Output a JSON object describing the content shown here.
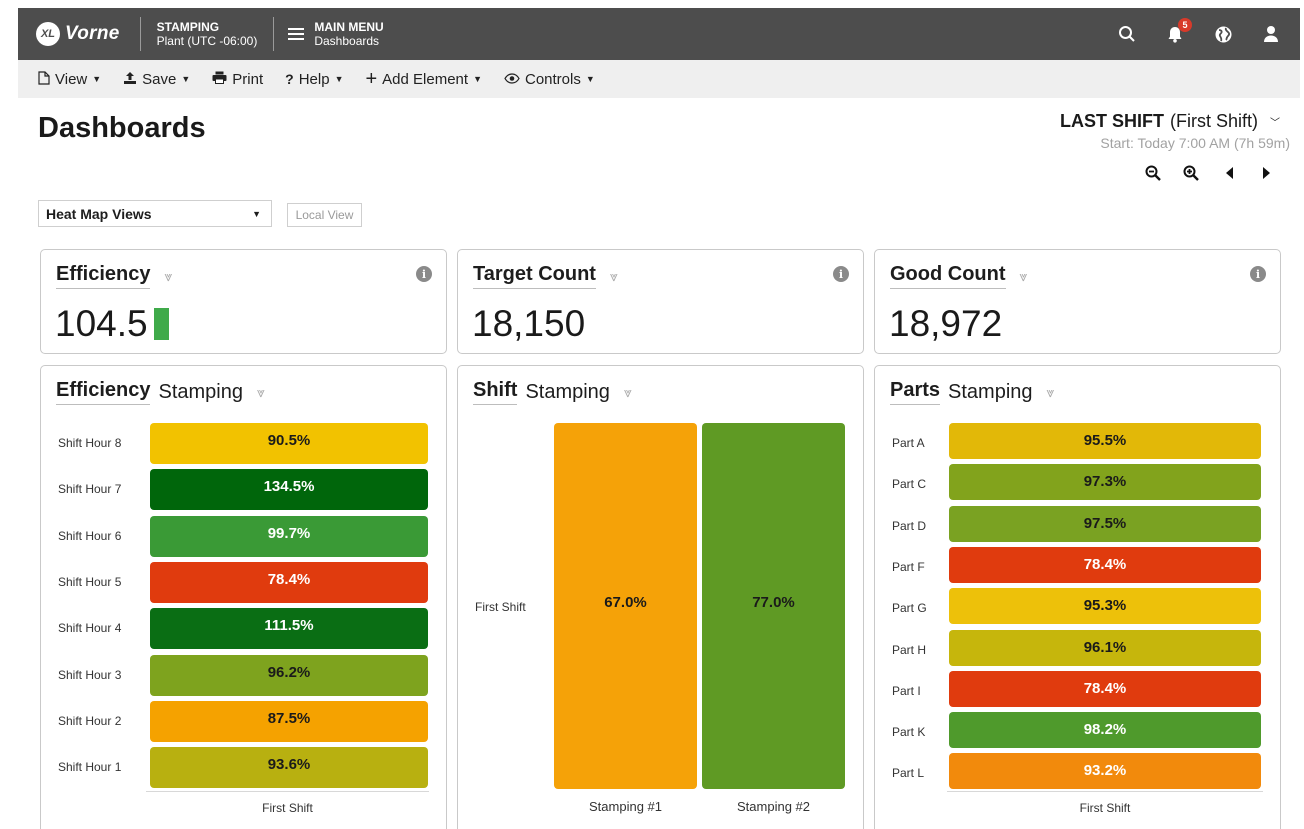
{
  "topbar": {
    "logo_badge": "XL",
    "logo_text": "Vorne",
    "area_title": "STAMPING",
    "area_sub": "Plant (UTC -06:00)",
    "menu_title": "MAIN MENU",
    "menu_sub": "Dashboards",
    "notification_count": "5"
  },
  "toolbar": {
    "view": "View",
    "save": "Save",
    "print": "Print",
    "help": "Help",
    "add_element": "Add Element",
    "controls": "Controls"
  },
  "header": {
    "title": "Dashboards",
    "shift_bold": "LAST SHIFT",
    "shift_name": "(First Shift)",
    "shift_start": "Start: Today 7:00 AM (7h 59m)"
  },
  "views": {
    "selected": "Heat Map Views",
    "local_view": "Local View"
  },
  "kpis": [
    {
      "title": "Efficiency",
      "value": "104.5",
      "indicator_color": "#3faa4a"
    },
    {
      "title": "Target Count",
      "value": "18,150"
    },
    {
      "title": "Good Count",
      "value": "18,972"
    }
  ],
  "efficiency_heatmap": {
    "title": "Efficiency",
    "subtitle": "Stamping",
    "x_label": "First Shift",
    "rows": [
      {
        "label": "Shift Hour 8",
        "value": "90.5%",
        "color": "#f2c200",
        "text_color": "#1a1a1a"
      },
      {
        "label": "Shift Hour 7",
        "value": "134.5%",
        "color": "#00660b",
        "text_color": "#ffffff"
      },
      {
        "label": "Shift Hour 6",
        "value": "99.7%",
        "color": "#3a9a36",
        "text_color": "#ffffff"
      },
      {
        "label": "Shift Hour 5",
        "value": "78.4%",
        "color": "#e03b0e",
        "text_color": "#ffffff"
      },
      {
        "label": "Shift Hour 4",
        "value": "111.5%",
        "color": "#0a6e14",
        "text_color": "#ffffff"
      },
      {
        "label": "Shift Hour 3",
        "value": "96.2%",
        "color": "#7ea31e",
        "text_color": "#1a1a1a"
      },
      {
        "label": "Shift Hour 2",
        "value": "87.5%",
        "color": "#f5a200",
        "text_color": "#1a1a1a"
      },
      {
        "label": "Shift Hour 1",
        "value": "93.6%",
        "color": "#b8b010",
        "text_color": "#1a1a1a"
      }
    ]
  },
  "shift_heatmap": {
    "title": "Shift",
    "subtitle": "Stamping",
    "y_label": "First Shift",
    "columns": [
      {
        "label": "Stamping #1",
        "value": "67.0%",
        "color": "#f5a208",
        "text_color": "#1a1a1a"
      },
      {
        "label": "Stamping #2",
        "value": "77.0%",
        "color": "#5f9a24",
        "text_color": "#1a1a1a"
      }
    ]
  },
  "parts_heatmap": {
    "title": "Parts",
    "subtitle": "Stamping",
    "x_label": "First Shift",
    "rows": [
      {
        "label": "Part A",
        "value": "95.5%",
        "color": "#e2b808",
        "text_color": "#1a1a1a"
      },
      {
        "label": "Part C",
        "value": "97.3%",
        "color": "#82a31c",
        "text_color": "#1a1a1a"
      },
      {
        "label": "Part D",
        "value": "97.5%",
        "color": "#7aa222",
        "text_color": "#1a1a1a"
      },
      {
        "label": "Part F",
        "value": "78.4%",
        "color": "#e03b0e",
        "text_color": "#ffffff"
      },
      {
        "label": "Part G",
        "value": "95.3%",
        "color": "#edc10a",
        "text_color": "#1a1a1a"
      },
      {
        "label": "Part H",
        "value": "96.1%",
        "color": "#c6b60c",
        "text_color": "#1a1a1a"
      },
      {
        "label": "Part I",
        "value": "78.4%",
        "color": "#e03b0e",
        "text_color": "#ffffff"
      },
      {
        "label": "Part K",
        "value": "98.2%",
        "color": "#4f9a2c",
        "text_color": "#ffffff"
      },
      {
        "label": "Part L",
        "value": "93.2%",
        "color": "#f28a0c",
        "text_color": "#ffffff"
      }
    ]
  }
}
